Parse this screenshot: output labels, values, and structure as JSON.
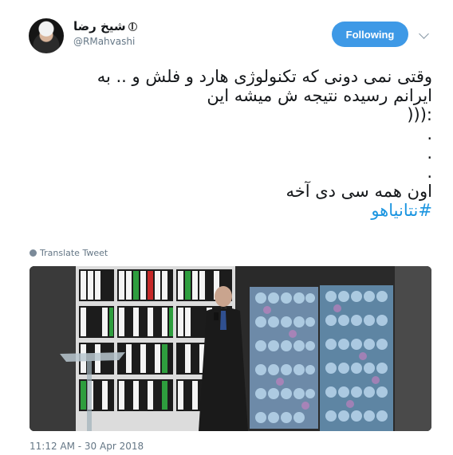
{
  "user": {
    "display_name": "شیخ رضا",
    "handle": "@RMahvashi"
  },
  "follow_button": {
    "label": "Following"
  },
  "tweet": {
    "lines": [
      "وقتی نمی دونی که تکنولوژی هارد و فلش و .. به",
      "ایرانم رسیده نتیجه ش میشه این",
      ":(((",
      ".",
      ".",
      ".",
      "اون همه سی دی آخه"
    ],
    "hashtag": "#نتانیاهو"
  },
  "translate_label": "Translate Tweet",
  "timestamp": "11:12 AM - 30 Apr 2018",
  "colors": {
    "accent": "#1b95e0",
    "follow_bg": "#3e99e6"
  }
}
